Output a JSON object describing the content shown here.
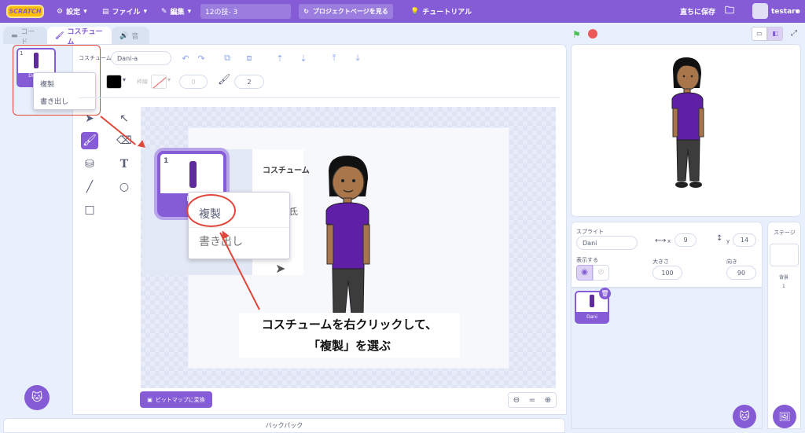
{
  "menubar": {
    "logo": "SCRATCH",
    "settings": "設定",
    "file": "ファイル",
    "edit": "編集",
    "project_title": "12の技- 3",
    "see_project": "プロジェクトページを見る",
    "tutorials": "チュートリアル",
    "save_now": "直ちに保存",
    "username": "testaro"
  },
  "tabs": {
    "code": "コード",
    "costumes": "コスチューム",
    "sounds": "音"
  },
  "costume_list": [
    {
      "number": "1",
      "name": "Dani-a",
      "size": "72"
    }
  ],
  "context_menu": {
    "duplicate": "複製",
    "export": "書き出し"
  },
  "paint_toolbar": {
    "costume_label": "コスチューム",
    "costume_name": "Dani-a",
    "outline_label": "枠線",
    "outline_width": "0",
    "brush_size": "2",
    "fill_color": "#000000"
  },
  "paint_actions": {
    "convert_bitmap": "ビットマップに変換",
    "zoom_reset": "="
  },
  "zoom_panel": {
    "costume_label": "コスチューム",
    "costume_number": "1",
    "costume_name_short": "Da",
    "costume_size_short": "72",
    "duplicate": "複製",
    "export": "書き出し",
    "partial_text": "氐"
  },
  "annotation": {
    "line1": "コスチュームを右クリックして、",
    "line2": "「複製」を選ぶ"
  },
  "sprite_info": {
    "sprite_label": "スプライト",
    "sprite_name": "Dani",
    "x_label": "x",
    "x_value": "9",
    "y_label": "y",
    "y_value": "14",
    "show_label": "表示する",
    "size_label": "大きさ",
    "size_value": "100",
    "direction_label": "向き",
    "direction_value": "90"
  },
  "sprite_list": [
    {
      "name": "Dani"
    }
  ],
  "stage_panel": {
    "title": "ステージ",
    "backdrops_label": "背景",
    "backdrop_count": "1"
  },
  "backpack": {
    "label": "バックパック"
  },
  "colors": {
    "accent": "#855cd6",
    "annotation_red": "#e0463a"
  }
}
